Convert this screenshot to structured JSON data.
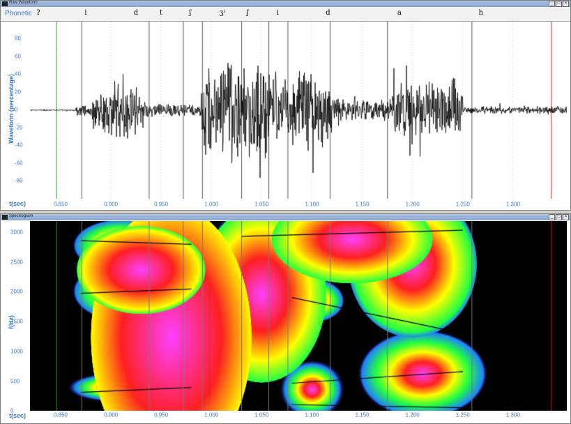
{
  "waveform_window": {
    "title": "Raw Waveform",
    "phonetic_label": "Phonetic",
    "ylabel": "Waveform (percentage)",
    "yticks": [
      "80",
      "60",
      "40",
      "20",
      "0",
      "-20",
      "-40",
      "-60",
      "-80"
    ],
    "segments": [
      {
        "label": "ʔ",
        "t": 0.857
      },
      {
        "label": "i",
        "t": 0.904
      },
      {
        "label": "d",
        "t": 0.954
      },
      {
        "label": "t",
        "t": 0.979
      },
      {
        "label": "ʃ",
        "t": 1.008
      },
      {
        "label": "ʒʲ",
        "t": 1.04
      },
      {
        "label": "ʃ",
        "t": 1.065
      },
      {
        "label": "i",
        "t": 1.095
      },
      {
        "label": "d",
        "t": 1.145
      },
      {
        "label": "a",
        "t": 1.216
      },
      {
        "label": "h",
        "t": 1.297
      }
    ],
    "boundaries": [
      0.846,
      0.871,
      0.938,
      0.972,
      0.991,
      1.03,
      1.057,
      1.076,
      1.118,
      1.175,
      1.259,
      1.338
    ]
  },
  "xaxis": {
    "label": "t(sec)",
    "ticks": [
      "0.850",
      "0.900",
      "0.950",
      "1.000",
      "1.050",
      "1.100",
      "1.150",
      "1.200",
      "1.250",
      "1.300"
    ]
  },
  "spectrogram_window": {
    "title": "Spectrogram",
    "ylabel": "f(Hz)",
    "yticks": [
      "3000",
      "2500",
      "2000",
      "1500",
      "1000",
      "500",
      "0"
    ]
  },
  "window_buttons": [
    "_",
    "□",
    "×"
  ],
  "colors": {
    "accent": "#3b7bd0",
    "boundary_start": "#2a9a2a",
    "boundary_end": "#d02020"
  }
}
